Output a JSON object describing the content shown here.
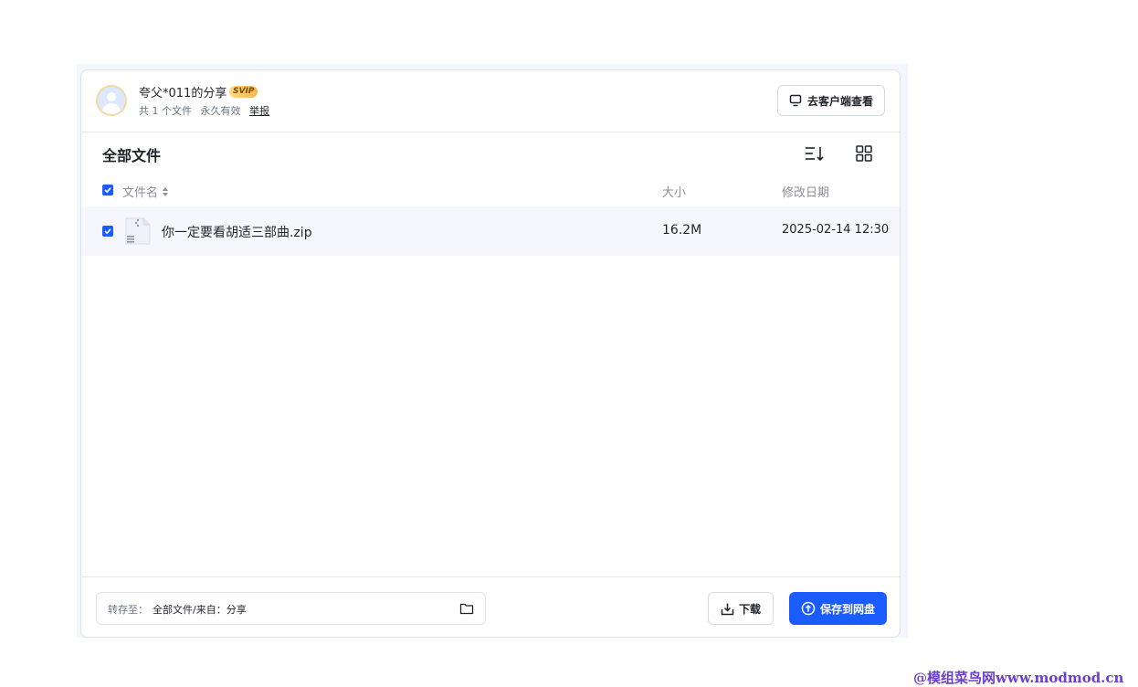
{
  "share_header": {
    "sharer_title": "夸父*011的分享",
    "vip_badge": "SVIP",
    "file_count": "共 1 个文件",
    "validity": "永久有效",
    "report_link": "举报",
    "open_client_button": "去客户端查看"
  },
  "file_list": {
    "section_title": "全部文件",
    "columns": {
      "name": "文件名",
      "size": "大小",
      "modified": "修改日期"
    },
    "rows": [
      {
        "name": "你一定要看胡适三部曲.zip",
        "size": "16.2M",
        "modified": "2025-02-14 12:30",
        "checked": true
      }
    ]
  },
  "footer": {
    "save_to_label": "转存至：",
    "save_to_path": "全部文件/来自：分享",
    "download_button": "下载",
    "save_button": "保存到网盘"
  },
  "watermark": "@模组菜鸟网www.modmod.cn",
  "colors": {
    "primary": "#1a5cff",
    "row_highlight": "#f5f7fc",
    "vip_gold": "#f6b84b"
  }
}
